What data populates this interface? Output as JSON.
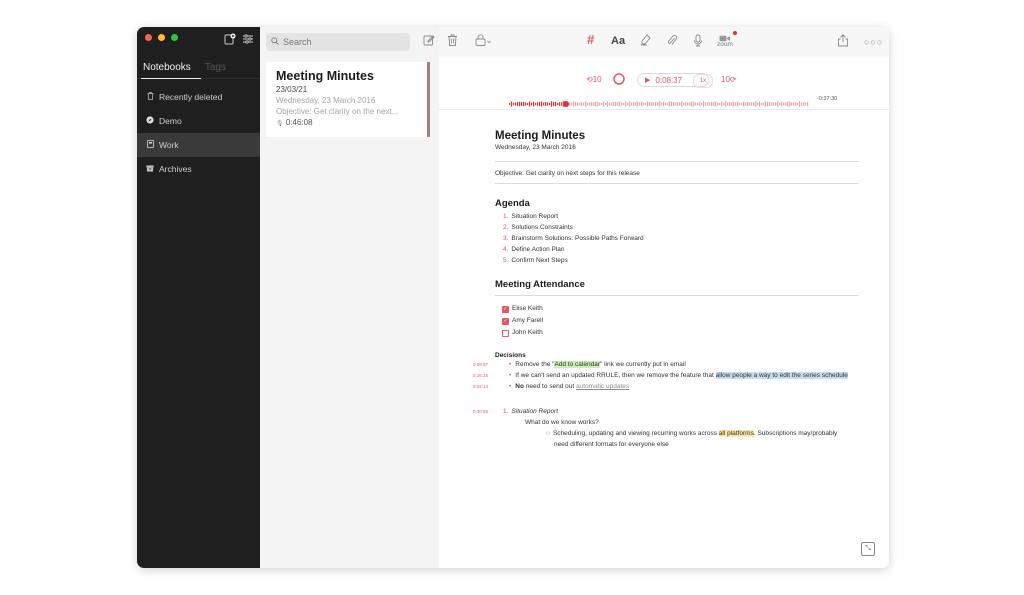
{
  "sidebar": {
    "tabs": [
      {
        "label": "Notebooks"
      },
      {
        "label": "Tags"
      }
    ],
    "items": [
      {
        "label": "Recently deleted",
        "icon": "trash-icon"
      },
      {
        "label": "Demo",
        "icon": "compass-icon"
      },
      {
        "label": "Work",
        "icon": "notebook-icon",
        "selected": true
      },
      {
        "label": "Archives",
        "icon": "archive-icon"
      }
    ]
  },
  "notelist": {
    "search_placeholder": "Search",
    "note": {
      "title": "Meeting Minutes",
      "date": "23/03/21",
      "subtitle_date": "Wednesday, 23 March 2016",
      "snippet": "Objective: Get clarity on the next...",
      "duration": "0:46:08"
    }
  },
  "toolbar": {
    "zoom_label": "zoom"
  },
  "audio": {
    "skip_back": "10",
    "skip_fwd": "10",
    "time": "0:08:37",
    "speed": "1x",
    "remaining": "-0:37:30",
    "progress": 0.19,
    "accent": "#e05a60"
  },
  "doc": {
    "title": "Meeting Minutes",
    "date": "Wednesday, 23 March 2016",
    "objective": "Objective: Get clarity on next steps for this release",
    "agenda_title": "Agenda",
    "agenda": [
      {
        "n": "1.",
        "text": "Situation Report"
      },
      {
        "n": "2.",
        "text": "Solutions Constraints"
      },
      {
        "n": "3.",
        "text": "Brainstorm Solutions: Possible Paths Forward"
      },
      {
        "n": "4.",
        "text": "Define Action Plan"
      },
      {
        "n": "5.",
        "text": "Confirm Next Steps"
      }
    ],
    "attendance_title": "Meeting Attendance",
    "attendees": [
      {
        "name": "Elise Keith",
        "checked": true
      },
      {
        "name": "Amy Farell",
        "checked": true
      },
      {
        "name": "John Keith",
        "checked": false
      }
    ],
    "decisions_title": "Decisions",
    "decisions": {
      "d1": {
        "ts": "0:08:07",
        "pre": "Remove the \"",
        "hl": "Add to calendar",
        "post": "\" link we currently put in email"
      },
      "d2": {
        "ts": "0:16:15",
        "pre": "If we can't send an updated RRULE, then we remove the feature that ",
        "hl": "allow people a way to edit the series schedule"
      },
      "d3": {
        "ts": "0:22:14",
        "bold": "No",
        "pre": " need to send out ",
        "link": "automatic updates"
      }
    },
    "situation": {
      "ts": "0:30:55",
      "n": "1.",
      "title": "Situation Report",
      "question": "What do we know works?",
      "line1_pre": "Scheduling, updating and viewing recurring works across ",
      "line1_hl": "all platforms",
      "line1_post": ". Subscriptions may/probably",
      "line2": "need different formats for everyone else"
    }
  }
}
